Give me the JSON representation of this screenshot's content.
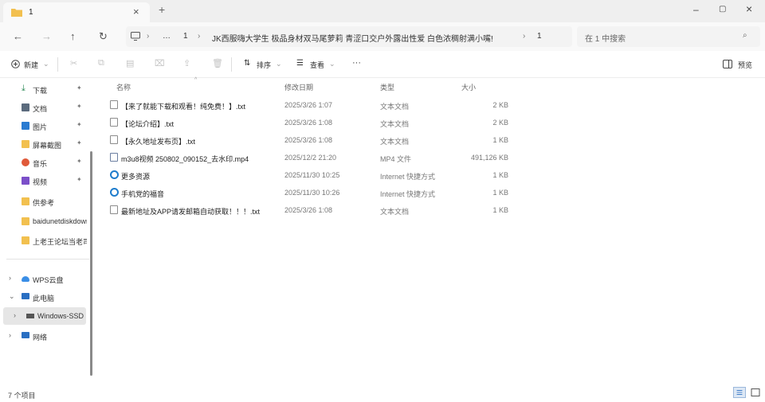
{
  "window": {
    "tab_title": "1",
    "tab_close": "×",
    "new_tab": "+",
    "minimize": "–",
    "maximize": "▢",
    "close": "×"
  },
  "nav": {
    "back": "←",
    "forward": "→",
    "up": "↑",
    "refresh": "↻",
    "breadcrumb": [
      "1",
      "JK西服嗨大学生 极品身材双马尾萝莉 青涩口交户外露出性爱 白色浓稠射满小嘴!",
      "1"
    ],
    "overflow": "…",
    "separator": "›",
    "search_placeholder": "在 1 中搜索",
    "search_icon": "⌕"
  },
  "toolbar": {
    "new_label": "新建",
    "sort_label": "排序",
    "view_label": "查看",
    "more": "···",
    "preview_label": "预览"
  },
  "sidebar": {
    "quick_access": [
      {
        "label": "下载",
        "icon": "download-icon",
        "color": "#2e8b57",
        "pinned": true
      },
      {
        "label": "文档",
        "icon": "documents-icon",
        "color": "#5b6b7d",
        "pinned": true
      },
      {
        "label": "图片",
        "icon": "pictures-icon",
        "color": "#2a7bd1",
        "pinned": true
      },
      {
        "label": "屏幕截图",
        "icon": "folder-icon",
        "color": "#f2c04f",
        "pinned": true
      },
      {
        "label": "音乐",
        "icon": "music-icon",
        "color": "#e05a3a",
        "pinned": true
      },
      {
        "label": "视频",
        "icon": "videos-icon",
        "color": "#7b4fc9",
        "pinned": true
      },
      {
        "label": "供参考",
        "icon": "folder-icon",
        "color": "#f2c04f",
        "pinned": false
      },
      {
        "label": "baidunetdiskdownload",
        "icon": "folder-icon",
        "color": "#f2c04f",
        "pinned": false
      },
      {
        "label": "上老王论坛当老司机",
        "icon": "folder-icon",
        "color": "#f2c04f",
        "pinned": false
      }
    ],
    "pin_glyph": "📌",
    "locations": [
      {
        "label": "WPS云盘",
        "icon": "cloud-icon",
        "color": "#3a8ee6",
        "expanded": false
      },
      {
        "label": "此电脑",
        "icon": "computer-icon",
        "color": "#2a6fc2",
        "expanded": true
      },
      {
        "label": "Windows-SSD",
        "icon": "drive-icon",
        "color": "#555555",
        "expanded": false,
        "selected": true
      },
      {
        "label": "网络",
        "icon": "network-icon",
        "color": "#2a6fc2",
        "expanded": false
      }
    ],
    "chev_collapsed": "›",
    "chev_expanded": "⌄"
  },
  "columns": {
    "name": "名称",
    "date": "修改日期",
    "type": "类型",
    "size": "大小",
    "sort_indicator": "^"
  },
  "files": [
    {
      "name": "【来了就能下载和观看！纯免费！】.txt",
      "date": "2025/3/26 1:07",
      "type": "文本文档",
      "size": "2 KB",
      "icon": "text-file-icon"
    },
    {
      "name": "【论坛介绍】.txt",
      "date": "2025/3/26 1:08",
      "type": "文本文档",
      "size": "2 KB",
      "icon": "text-file-icon"
    },
    {
      "name": "【永久地址发布页】.txt",
      "date": "2025/3/26 1:08",
      "type": "文本文档",
      "size": "1 KB",
      "icon": "text-file-icon"
    },
    {
      "name": "m3u8视频 250802_090152_去水印.mp4",
      "date": "2025/12/2 21:20",
      "type": "MP4 文件",
      "size": "491,126 KB",
      "icon": "video-file-icon"
    },
    {
      "name": "更多资源",
      "date": "2025/11/30 10:25",
      "type": "Internet 快捷方式",
      "size": "1 KB",
      "icon": "internet-shortcut-icon"
    },
    {
      "name": "手机党的福音",
      "date": "2025/11/30 10:26",
      "type": "Internet 快捷方式",
      "size": "1 KB",
      "icon": "internet-shortcut-icon"
    },
    {
      "name": "最新地址及APP请发邮箱自动获取！！！.txt",
      "date": "2025/3/26 1:08",
      "type": "文本文档",
      "size": "1 KB",
      "icon": "text-file-icon"
    }
  ],
  "status": {
    "item_count": "7 个项目"
  },
  "colors": {
    "folder": "#f2c04f",
    "link": "#1e7ccc",
    "selected_bg": "#e6e6e6"
  }
}
